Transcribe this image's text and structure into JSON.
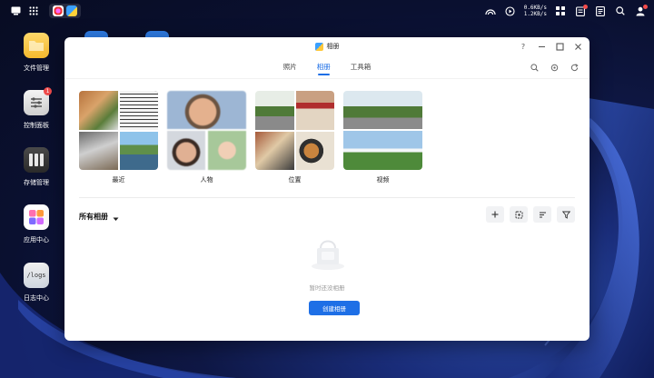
{
  "topbar": {
    "upload_speed": "0.6KB/s",
    "download_speed": "1.2KB/s",
    "left_icons": [
      "desktop-icon",
      "grid-icon"
    ],
    "right_icons": [
      "network-icon",
      "media-icon",
      "apps-icon",
      "clipboard-icon",
      "notes-icon",
      "search-icon",
      "user-icon"
    ]
  },
  "desktop": {
    "icons": [
      {
        "label": "文件管理",
        "icon": "folder-icon"
      },
      {
        "label": "控制面板",
        "icon": "control-panel-icon",
        "badge": "1"
      },
      {
        "label": "存储管理",
        "icon": "storage-icon"
      },
      {
        "label": "应用中心",
        "icon": "app-center-icon"
      },
      {
        "label": "日志中心",
        "icon": "logs-icon",
        "tile_text": "/logs"
      }
    ]
  },
  "window": {
    "title": "相册",
    "tabs": [
      {
        "label": "照片",
        "active": false
      },
      {
        "label": "相册",
        "active": true
      },
      {
        "label": "工具箱",
        "active": false
      }
    ],
    "categories": [
      {
        "label": "最近"
      },
      {
        "label": "人物"
      },
      {
        "label": "位置"
      },
      {
        "label": "视频"
      }
    ],
    "albums_title": "所有相册",
    "empty_text": "暂时还没相册",
    "create_button": "创建相册"
  },
  "colors": {
    "accent": "#1e6fe6",
    "desktop_bg": "#0f1846"
  }
}
